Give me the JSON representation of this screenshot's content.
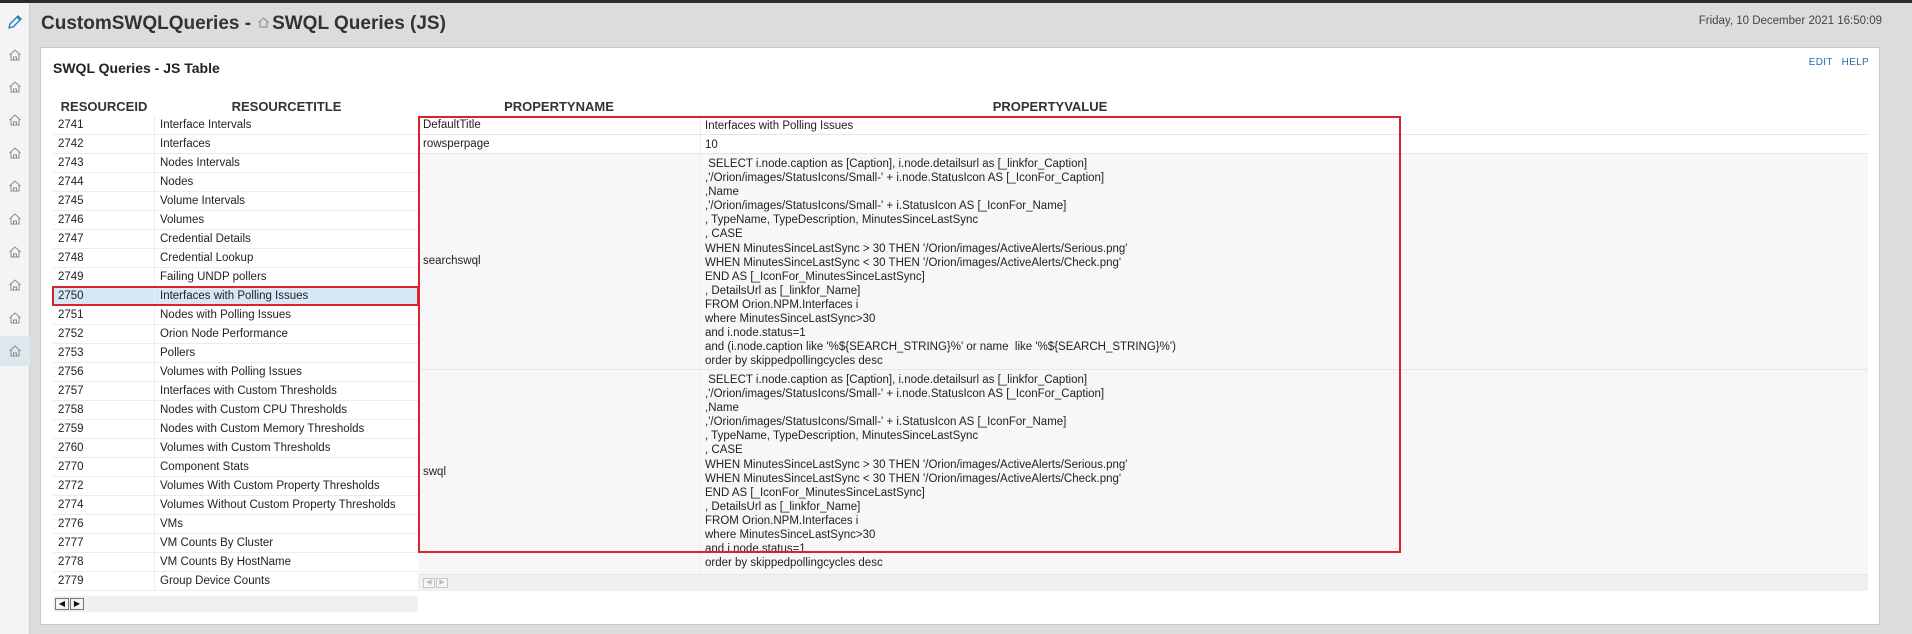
{
  "header": {
    "title_part1": "CustomSWQLQueries - ",
    "title_part2": "SWQL Queries (JS)",
    "datetime": "Friday, 10 December 2021 16:50:09"
  },
  "sidebar": {
    "edit_icon": "pencil-icon",
    "items": [
      "home-icon",
      "home-icon",
      "home-icon",
      "home-icon",
      "home-icon",
      "home-icon",
      "home-icon",
      "home-icon",
      "home-icon",
      "home-icon"
    ],
    "active_index": 9
  },
  "panel": {
    "title": "SWQL Queries - JS Table",
    "edit_label": "EDIT",
    "help_label": "HELP"
  },
  "left_table": {
    "columns": [
      "RESOURCEID",
      "RESOURCETITLE"
    ],
    "selected_id": "2750",
    "rows": [
      {
        "id": "2741",
        "title": "Interface Intervals"
      },
      {
        "id": "2742",
        "title": "Interfaces"
      },
      {
        "id": "2743",
        "title": "Nodes Intervals"
      },
      {
        "id": "2744",
        "title": "Nodes"
      },
      {
        "id": "2745",
        "title": "Volume Intervals"
      },
      {
        "id": "2746",
        "title": "Volumes"
      },
      {
        "id": "2747",
        "title": "Credential Details"
      },
      {
        "id": "2748",
        "title": "Credential Lookup"
      },
      {
        "id": "2749",
        "title": "Failing UNDP pollers"
      },
      {
        "id": "2750",
        "title": "Interfaces with Polling Issues"
      },
      {
        "id": "2751",
        "title": "Nodes with Polling Issues"
      },
      {
        "id": "2752",
        "title": "Orion Node Performance"
      },
      {
        "id": "2753",
        "title": "Pollers"
      },
      {
        "id": "2756",
        "title": "Volumes with Polling Issues"
      },
      {
        "id": "2757",
        "title": "Interfaces with Custom Thresholds"
      },
      {
        "id": "2758",
        "title": "Nodes with Custom CPU Thresholds"
      },
      {
        "id": "2759",
        "title": "Nodes with Custom Memory Thresholds"
      },
      {
        "id": "2760",
        "title": "Volumes with Custom Thresholds"
      },
      {
        "id": "2770",
        "title": "Component Stats"
      },
      {
        "id": "2772",
        "title": "Volumes With Custom Property Thresholds"
      },
      {
        "id": "2774",
        "title": "Volumes Without Custom Property Thresholds"
      },
      {
        "id": "2776",
        "title": "VMs"
      },
      {
        "id": "2777",
        "title": "VM Counts By Cluster"
      },
      {
        "id": "2778",
        "title": "VM Counts By HostName"
      },
      {
        "id": "2779",
        "title": "Group Device Counts"
      }
    ],
    "nav_prev": "◀",
    "nav_next": "▶"
  },
  "right_table": {
    "columns": [
      "PROPERTYNAME",
      "PROPERTYVALUE"
    ],
    "rows": [
      {
        "name": "DefaultTitle",
        "value": "Interfaces with Polling Issues"
      },
      {
        "name": "rowsperpage",
        "value": "10"
      },
      {
        "name": "searchswql",
        "value": " SELECT i.node.caption as [Caption], i.node.detailsurl as [_linkfor_Caption]\n,'/Orion/images/StatusIcons/Small-' + i.node.StatusIcon AS [_IconFor_Caption]\n,Name\n,'/Orion/images/StatusIcons/Small-' + i.StatusIcon AS [_IconFor_Name]\n, TypeName, TypeDescription, MinutesSinceLastSync\n, CASE\nWHEN MinutesSinceLastSync > 30 THEN '/Orion/images/ActiveAlerts/Serious.png'\nWHEN MinutesSinceLastSync < 30 THEN '/Orion/images/ActiveAlerts/Check.png'\nEND AS [_IconFor_MinutesSinceLastSync]\n, DetailsUrl as [_linkfor_Name]\nFROM Orion.NPM.Interfaces i\nwhere MinutesSinceLastSync>30\nand i.node.status=1\nand (i.node.caption like '%${SEARCH_STRING}%' or name  like '%${SEARCH_STRING}%')\norder by skippedpollingcycles desc"
      },
      {
        "name": "swql",
        "value": " SELECT i.node.caption as [Caption], i.node.detailsurl as [_linkfor_Caption]\n,'/Orion/images/StatusIcons/Small-' + i.node.StatusIcon AS [_IconFor_Caption]\n,Name\n,'/Orion/images/StatusIcons/Small-' + i.StatusIcon AS [_IconFor_Name]\n, TypeName, TypeDescription, MinutesSinceLastSync\n, CASE\nWHEN MinutesSinceLastSync > 30 THEN '/Orion/images/ActiveAlerts/Serious.png'\nWHEN MinutesSinceLastSync < 30 THEN '/Orion/images/ActiveAlerts/Check.png'\nEND AS [_IconFor_MinutesSinceLastSync]\n, DetailsUrl as [_linkfor_Name]\nFROM Orion.NPM.Interfaces i\nwhere MinutesSinceLastSync>30\nand i.node.status=1\norder by skippedpollingcycles desc"
      }
    ],
    "nav_prev": "◀",
    "nav_next": "▶"
  },
  "colors": {
    "highlight_border": "#d9232e",
    "selected_row": "#d6e7f6",
    "link": "#2a6db0"
  }
}
